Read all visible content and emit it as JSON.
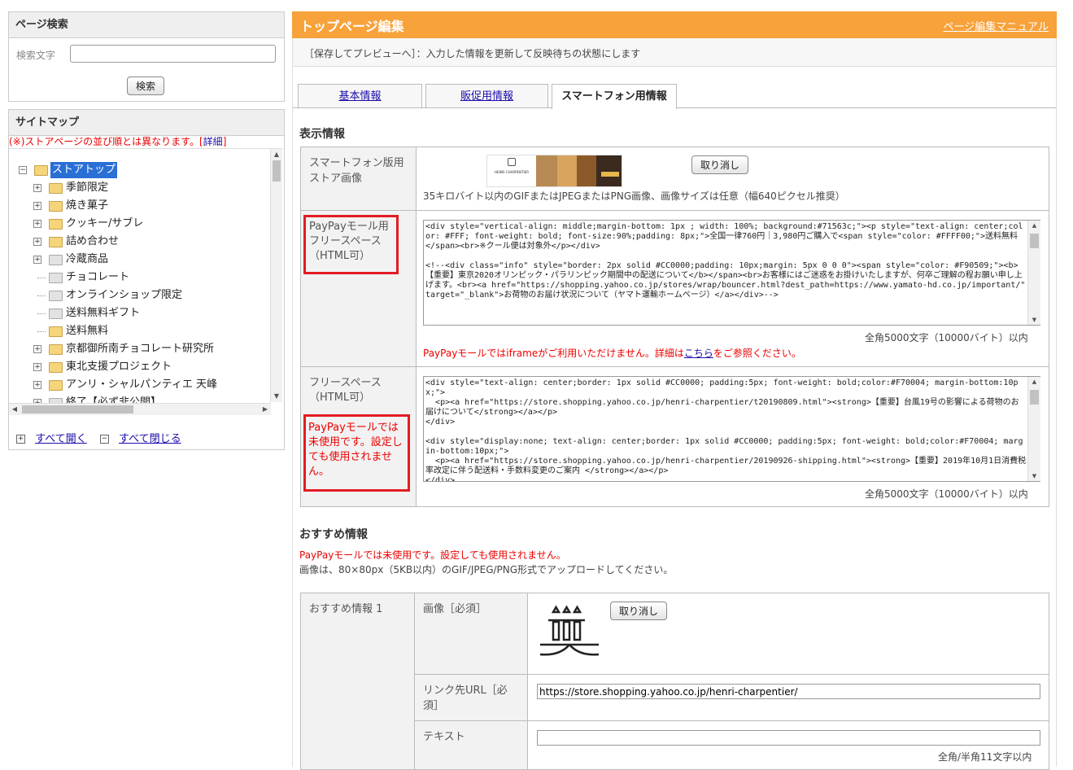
{
  "sidebar": {
    "search": {
      "title": "ページ検索",
      "label": "検索文字",
      "value": "",
      "button": "検索"
    },
    "sitemap": {
      "title": "サイトマップ",
      "note": "(※)ストアページの並び順とは異なります。[",
      "note_link": "詳細",
      "note_end": "]",
      "root": "ストアトップ",
      "items": [
        {
          "label": "季節限定",
          "toggle": "+",
          "folder": "yellow"
        },
        {
          "label": "焼き菓子",
          "toggle": "+",
          "folder": "yellow"
        },
        {
          "label": "クッキー/サブレ",
          "toggle": "+",
          "folder": "yellow"
        },
        {
          "label": "詰め合わせ",
          "toggle": "+",
          "folder": "yellow"
        },
        {
          "label": "冷蔵商品",
          "toggle": "+",
          "folder": "grey"
        },
        {
          "label": "チョコレート",
          "toggle": "",
          "folder": "grey"
        },
        {
          "label": "オンラインショップ限定",
          "toggle": "",
          "folder": "grey"
        },
        {
          "label": "送料無料ギフト",
          "toggle": "",
          "folder": "grey"
        },
        {
          "label": "送料無料",
          "toggle": "",
          "folder": "yellow"
        },
        {
          "label": "京都御所南チョコレート研究所",
          "toggle": "+",
          "folder": "yellow"
        },
        {
          "label": "東北支援プロジェクト",
          "toggle": "+",
          "folder": "yellow"
        },
        {
          "label": "アンリ・シャルパンティエ 天峰",
          "toggle": "+",
          "folder": "yellow"
        },
        {
          "label": "終了【必ず非公開】",
          "toggle": "+",
          "folder": "grey"
        }
      ],
      "open_all": "すべて開く",
      "close_all": "すべて閉じる"
    }
  },
  "header": {
    "title": "トップページ編集",
    "manual_link": "ページ編集マニュアル",
    "notice": "［保存してプレビューへ］：入力した情報を更新して反映待ちの状態にします"
  },
  "tabs": [
    "基本情報",
    "販促用情報",
    "スマートフォン用情報"
  ],
  "display": {
    "section_title": "表示情報",
    "store_image_label": "スマートフォン版用ストア画像",
    "banner_brand": "HENRI CHARPENTIER",
    "cancel": "取り消し",
    "image_note": "35キロバイト以内のGIFまたはJPEGまたはPNG画像、画像サイズは任意（幅640ピクセル推奨）",
    "paypay_label": "PayPayモール用フリースペース（HTML可）",
    "paypay_html": "<div style=\"vertical-align: middle;margin-bottom: 1px ; width: 100%; background:#71563c;\"><p style=\"text-align: center;color: #FFF; font-weight: bold; font-size:90%;padding: 8px;\">全国一律760円｜3,980円ご購入で<span style=\"color: #FFFF00;\">送料無料</span><br>※クール便は対象外</p></div>\n\n<!--<div class=\"info\" style=\"border: 2px solid #CC0000;padding: 10px;margin: 5px 0 0 0\"><span style=\"color: #F90509;\"><b>【重要】東京2020オリンピック・パラリンピック期間中の配送について</b></span><br>お客様にはご迷惑をお掛けいたしますが、何卒ご理解の程お願い申し上げます。<br><a href=\"https://shopping.yahoo.co.jp/stores/wrap/bouncer.html?dest_path=https://www.yamato-hd.co.jp/important/\" target=\"_blank\">お荷物のお届け状況について（ヤマト運輸ホームページ）</a></div>-->",
    "char_limit": "全角5000文字（10000バイト）以内",
    "iframe_note_pre": "PayPayモールではiframeがご利用いただけません。詳細は",
    "iframe_note_link": "こちら",
    "iframe_note_post": "をご参照ください。",
    "free_label": "フリースペース（HTML可）",
    "free_unused": "PayPayモールでは未使用です。設定しても使用されません。",
    "free_html": "<div style=\"text-align: center;border: 1px solid #CC0000; padding:5px; font-weight: bold;color:#F70004; margin-bottom:10px;\">\n  <p><a href=\"https://store.shopping.yahoo.co.jp/henri-charpentier/t20190809.html\"><strong>【重要】台風19号の影響による荷物のお届けについて</strong></a></p>\n</div>\n\n<div style=\"display:none; text-align: center;border: 1px solid #CC0000; padding:5px; font-weight: bold;color:#F70004; margin-bottom:10px;\">\n  <p><a href=\"https://store.shopping.yahoo.co.jp/henri-charpentier/20190926-shipping.html\"><strong>【重要】2019年10月1日消費税率改定に伴う配送料・手数料変更のご案内 </strong></a></p>\n</div>"
  },
  "recommend": {
    "section_title": "おすすめ情報",
    "unused_note": "PayPayモールでは未使用です。設定しても使用されません。",
    "image_note": "画像は、80×80px（5KB以内）のGIF/JPEG/PNG形式でアップロードしてください。",
    "item_label": "おすすめ情報 1",
    "image_label": "画像［必須］",
    "cancel": "取り消し",
    "url_label": "リンク先URL［必須］",
    "url_value": "https://store.shopping.yahoo.co.jp/henri-charpentier/",
    "text_label": "テキスト",
    "text_value": "",
    "text_limit": "全角/半角11文字以内"
  },
  "colors": {
    "header_orange": "#f7a23a",
    "alert_red": "#e31b23",
    "selection_blue": "#2a6fd6"
  }
}
